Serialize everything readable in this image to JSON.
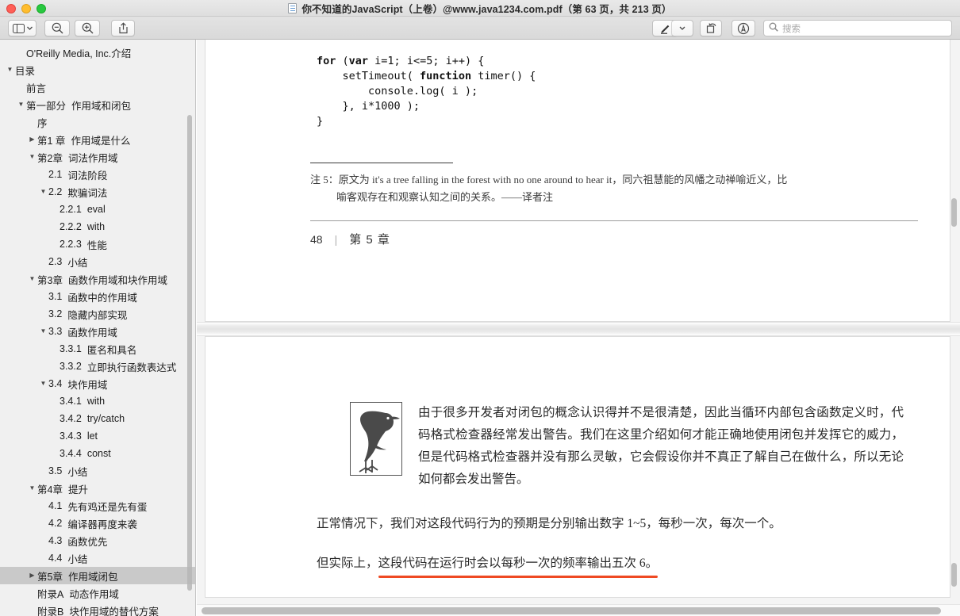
{
  "window": {
    "title": "你不知道的JavaScript（上卷）@www.java1234.com.pdf（第 63 页，共 213 页）",
    "traffic_lights": [
      {
        "name": "close",
        "color": "#ff5f57"
      },
      {
        "name": "minimize",
        "color": "#ffbd2e"
      },
      {
        "name": "zoom",
        "color": "#28c840"
      }
    ]
  },
  "toolbar": {
    "sidebar_toggle": "sidebar-view-icon",
    "sidebar_chevron": "chevron-down-icon",
    "zoom_out": "zoom-out-icon",
    "zoom_in": "zoom-in-icon",
    "share": "share-icon",
    "markup": "markup-pen-icon",
    "markup_chevron": "chevron-down-icon",
    "rotate": "rotate-icon",
    "annotate": "annotate-icon",
    "search_icon": "search-icon",
    "search_value": "",
    "search_placeholder": "搜索"
  },
  "sidebar": {
    "scrollbar": "vertical-scrollbar",
    "items": [
      {
        "twisty": "",
        "indent": 1,
        "num": "",
        "label": "O'Reilly Media, Inc.介绍",
        "selected": false
      },
      {
        "twisty": "▼",
        "indent": 0,
        "num": "",
        "label": "目录",
        "selected": false
      },
      {
        "twisty": "",
        "indent": 1,
        "num": "",
        "label": "前言",
        "selected": false
      },
      {
        "twisty": "▼",
        "indent": 1,
        "num": "第一部分",
        "label": "作用域和闭包",
        "selected": false
      },
      {
        "twisty": "",
        "indent": 2,
        "num": "",
        "label": "序",
        "selected": false
      },
      {
        "twisty": "▶",
        "indent": 2,
        "num": "第1 章",
        "label": "作用域是什么",
        "selected": false
      },
      {
        "twisty": "▼",
        "indent": 2,
        "num": "第2章",
        "label": "词法作用域",
        "selected": false
      },
      {
        "twisty": "",
        "indent": 3,
        "num": "2.1",
        "label": "词法阶段",
        "selected": false
      },
      {
        "twisty": "▼",
        "indent": 3,
        "num": "2.2",
        "label": "欺骗词法",
        "selected": false
      },
      {
        "twisty": "",
        "indent": 4,
        "num": "2.2.1",
        "label": "eval",
        "selected": false
      },
      {
        "twisty": "",
        "indent": 4,
        "num": "2.2.2",
        "label": "with",
        "selected": false
      },
      {
        "twisty": "",
        "indent": 4,
        "num": "2.2.3",
        "label": "性能",
        "selected": false
      },
      {
        "twisty": "",
        "indent": 3,
        "num": "2.3",
        "label": "小结",
        "selected": false
      },
      {
        "twisty": "▼",
        "indent": 2,
        "num": "第3章",
        "label": "函数作用域和块作用域",
        "selected": false
      },
      {
        "twisty": "",
        "indent": 3,
        "num": "3.1",
        "label": "函数中的作用域",
        "selected": false
      },
      {
        "twisty": "",
        "indent": 3,
        "num": "3.2",
        "label": "隐藏内部实现",
        "selected": false
      },
      {
        "twisty": "▼",
        "indent": 3,
        "num": "3.3",
        "label": "函数作用域",
        "selected": false
      },
      {
        "twisty": "",
        "indent": 4,
        "num": "3.3.1",
        "label": "匿名和具名",
        "selected": false
      },
      {
        "twisty": "",
        "indent": 4,
        "num": "3.3.2",
        "label": "立即执行函数表达式",
        "selected": false
      },
      {
        "twisty": "▼",
        "indent": 3,
        "num": "3.4",
        "label": "块作用域",
        "selected": false
      },
      {
        "twisty": "",
        "indent": 4,
        "num": "3.4.1",
        "label": "with",
        "selected": false
      },
      {
        "twisty": "",
        "indent": 4,
        "num": "3.4.2",
        "label": "try/catch",
        "selected": false
      },
      {
        "twisty": "",
        "indent": 4,
        "num": "3.4.3",
        "label": "let",
        "selected": false
      },
      {
        "twisty": "",
        "indent": 4,
        "num": "3.4.4",
        "label": "const",
        "selected": false
      },
      {
        "twisty": "",
        "indent": 3,
        "num": "3.5",
        "label": "小结",
        "selected": false
      },
      {
        "twisty": "▼",
        "indent": 2,
        "num": "第4章",
        "label": "提升",
        "selected": false
      },
      {
        "twisty": "",
        "indent": 3,
        "num": "4.1",
        "label": "先有鸡还是先有蛋",
        "selected": false
      },
      {
        "twisty": "",
        "indent": 3,
        "num": "4.2",
        "label": "编译器再度来袭",
        "selected": false
      },
      {
        "twisty": "",
        "indent": 3,
        "num": "4.3",
        "label": "函数优先",
        "selected": false
      },
      {
        "twisty": "",
        "indent": 3,
        "num": "4.4",
        "label": "小结",
        "selected": false
      },
      {
        "twisty": "▶",
        "indent": 2,
        "num": "第5章",
        "label": "作用域闭包",
        "selected": true
      },
      {
        "twisty": "",
        "indent": 2,
        "num": "附录A",
        "label": "动态作用域",
        "selected": false
      },
      {
        "twisty": "",
        "indent": 2,
        "num": "附录B",
        "label": "块作用域的替代方案",
        "selected": false
      }
    ]
  },
  "pdf": {
    "page1": {
      "code_lines": [
        "for (var i=1; i<=5; i++) {",
        "    setTimeout( function timer() {",
        "        console.log( i );",
        "    }, i*1000 );",
        "}"
      ],
      "footnote_line1": "注 5：原文为 it's a tree falling in the forest with no one around to hear it，同六祖慧能的风幡之动禅喻近义，比",
      "footnote_line2": "喻客观存在和观察认知之间的关系。——译者注",
      "footer_page_number": "48",
      "footer_separator": "|",
      "footer_chapter": "第 5 章"
    },
    "page2": {
      "note_icon": "crow-bird-icon",
      "note_text": "由于很多开发者对闭包的概念认识得并不是很清楚，因此当循环内部包含函数定义时，代码格式检查器经常发出警告。我们在这里介绍如何才能正确地使用闭包并发挥它的威力，但是代码格式检查器并没有那么灵敏，它会假设你并不真正了解自己在做什么，所以无论如何都会发出警告。",
      "paragraph_1": "正常情况下，我们对这段代码行为的预期是分别输出数字 1~5，每秒一次，每次一个。",
      "paragraph_2_prefix": "但实际上，",
      "paragraph_2_highlighted": "这段代码在运行时会以每秒一次的频率输出五次 6。",
      "highlight_color": "#ef4a23"
    },
    "vertical_scrollbar": "pdf-vertical-scrollbar",
    "horizontal_scrollbar": "pdf-horizontal-scrollbar"
  }
}
